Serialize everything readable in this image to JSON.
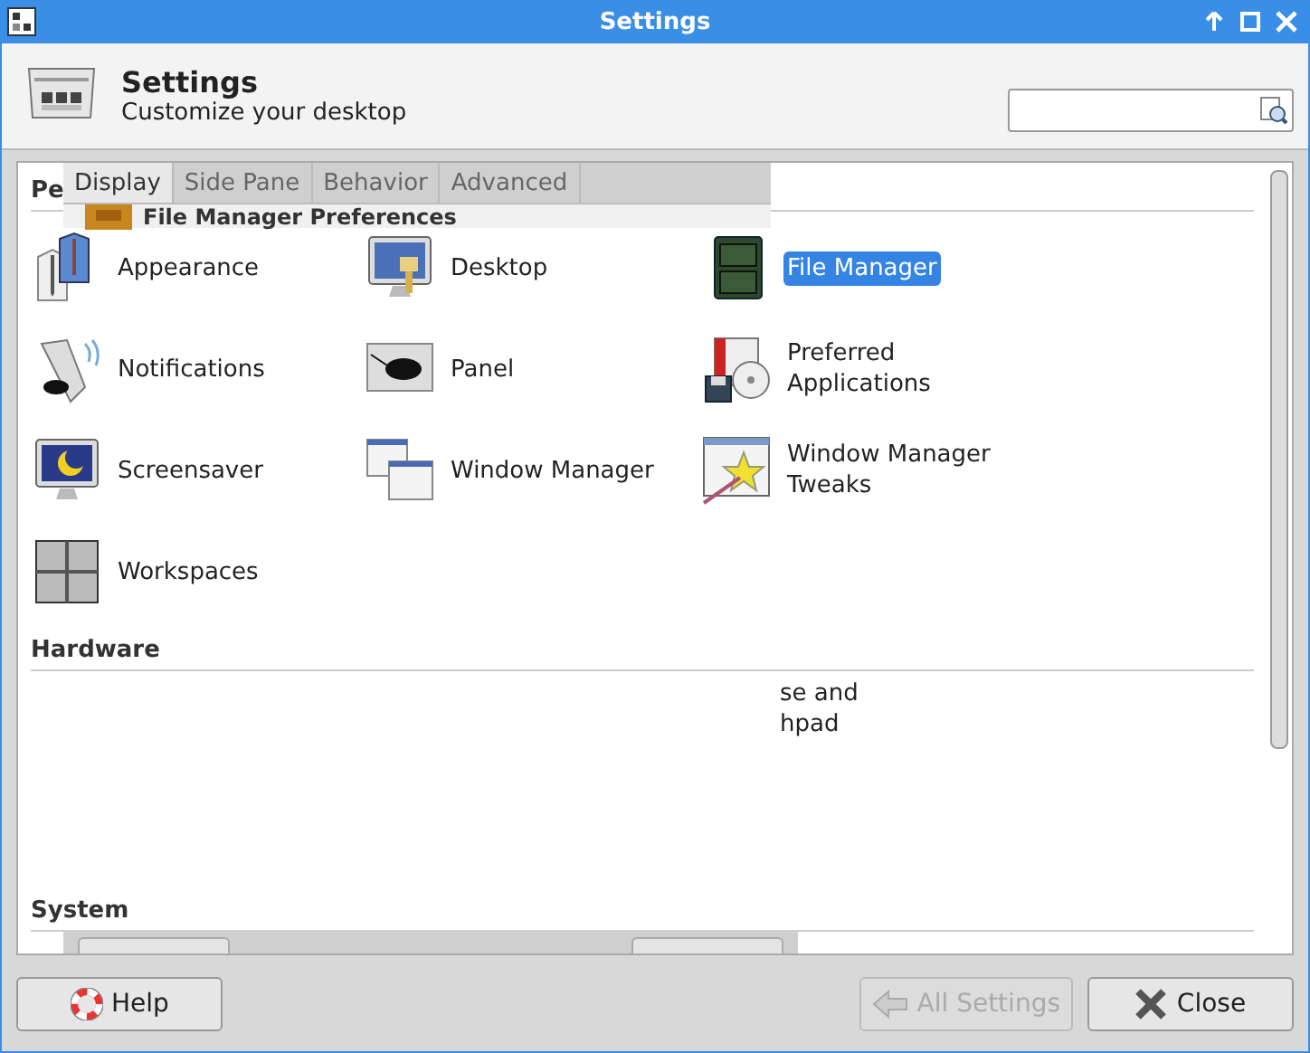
{
  "window": {
    "title": "Settings"
  },
  "header": {
    "title": "Settings",
    "subtitle": "Customize your desktop"
  },
  "overlay_dialog": {
    "tabs": [
      {
        "label": "Display",
        "selected": true
      },
      {
        "label": "Side Pane",
        "selected": false
      },
      {
        "label": "Behavior",
        "selected": false
      },
      {
        "label": "Advanced",
        "selected": false
      }
    ],
    "title": "File Manager Preferences"
  },
  "sections": [
    {
      "heading": "Pe",
      "items": [
        {
          "label": "Appearance",
          "selected": false
        },
        {
          "label": "Desktop",
          "selected": false
        },
        {
          "label": "File Manager",
          "selected": true
        },
        {
          "label": "Notifications",
          "selected": false
        },
        {
          "label": "Panel",
          "selected": false
        },
        {
          "label": "Preferred Applications",
          "selected": false
        },
        {
          "label": "Screensaver",
          "selected": false
        },
        {
          "label": "Window Manager",
          "selected": false
        },
        {
          "label": "Window Manager Tweaks",
          "selected": false
        },
        {
          "label": "Workspaces",
          "selected": false
        }
      ]
    },
    {
      "heading": "Hardware",
      "items": [
        {
          "label": "se and hpad",
          "selected": false,
          "kind": "partial"
        }
      ]
    },
    {
      "heading": "System"
    }
  ],
  "buttons": [
    {
      "label": "Help",
      "disabled": false
    },
    {
      "label": "All Settings",
      "disabled": true
    },
    {
      "label": "Close",
      "disabled": false
    }
  ]
}
